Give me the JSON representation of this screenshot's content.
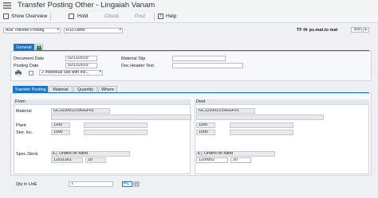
{
  "window": {
    "title": "Transfer Posting Other - Lingaiah Vanam"
  },
  "toolbar": {
    "show_overview": "Show Overview",
    "hold": "Hold",
    "check": "Check",
    "post": "Post",
    "help": "Help"
  },
  "header": {
    "transaction_select": "A08 Transfer Posting",
    "reference_select": "R10 Other",
    "movement_label": "TF tfr ps.mat.to mat",
    "movement_type": "309",
    "movement_extra": "E"
  },
  "general": {
    "tab_label": "General",
    "document_date_label": "Document Date",
    "document_date": "02/11/2019",
    "posting_date_label": "Posting Date",
    "posting_date": "02/11/2019",
    "material_slip_label": "Material Slip",
    "material_slip": "",
    "doc_header_text_label": "Doc.Header Text",
    "doc_header_text": "",
    "slip_select": "2 Individual Slip with Ins..."
  },
  "item_tabs": [
    "Transfer Posting",
    "Material",
    "Quantity",
    "Where"
  ],
  "from": {
    "heading": "From",
    "material_label": "Material",
    "material": "GC122001219GGF01",
    "plant_label": "Plant",
    "plant": "1100",
    "stor_loc_label": "Stor. loc.",
    "stor_loc": "1000",
    "spec_stock_label": "Spec.Stock",
    "spec_stock_code": "E",
    "spec_stock_text": "Orders on hand",
    "sales_order": "12011261",
    "sales_order_item": "10"
  },
  "dest": {
    "heading": "Dest",
    "material": "GC122001219GGF01",
    "plant": "1100",
    "stor_loc": "1000",
    "spec_stock_code": "E",
    "spec_stock_text": "Orders on hand",
    "sales_order": "1200002",
    "sales_order_item": "20"
  },
  "quantity": {
    "label": "Qty in UnE",
    "value": "1",
    "unit": "PC"
  },
  "colors": {
    "accent": "#1a73c5",
    "background": "#eef0f3"
  },
  "icons": [
    "menu-icon",
    "show-overview-icon",
    "hold-icon",
    "help-icon",
    "people-icon",
    "unit-picker-icon"
  ]
}
